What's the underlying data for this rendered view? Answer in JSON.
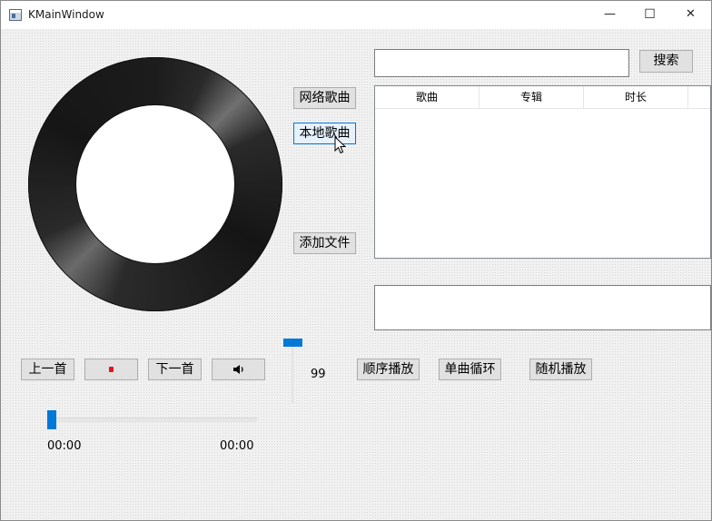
{
  "window": {
    "title": "KMainWindow",
    "minimize": "—",
    "maximize": "☐",
    "close": "✕"
  },
  "search": {
    "value": "",
    "button": "搜索"
  },
  "source_buttons": {
    "online": "网络歌曲",
    "local": "本地歌曲",
    "add_file": "添加文件"
  },
  "table": {
    "columns": [
      "歌曲",
      "专辑",
      "时长"
    ]
  },
  "lyrics_box": {
    "value": ""
  },
  "playback": {
    "prev": "上一首",
    "next": "下一首",
    "play_icon": "stop-icon",
    "volume_icon": "speaker-icon"
  },
  "volume": {
    "value": "99",
    "level": 0.99
  },
  "modes": {
    "sequential": "顺序播放",
    "single_loop": "单曲循环",
    "random": "随机播放"
  },
  "progress": {
    "current": "00:00",
    "total": "00:00",
    "fraction": 0
  },
  "colors": {
    "accent": "#0078d7",
    "disc": "#1c1c1c",
    "stop": "#e81123"
  }
}
